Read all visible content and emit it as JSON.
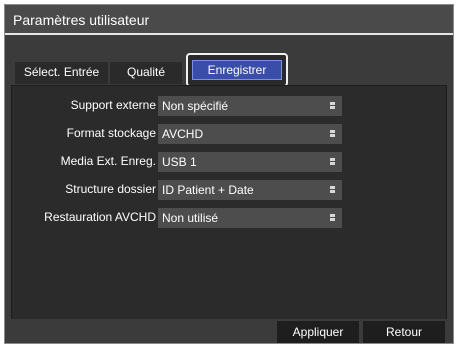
{
  "window": {
    "title": "Paramètres utilisateur"
  },
  "tabs": [
    {
      "label": "Sélect. Entrée"
    },
    {
      "label": "Qualité"
    },
    {
      "label": "Enregistrer",
      "active": true
    }
  ],
  "settings": [
    {
      "label": "Support externe",
      "value": "Non spécifié",
      "icon": "dropdown-icon"
    },
    {
      "label": "Format stockage",
      "value": "AVCHD",
      "icon": "dropdown-icon"
    },
    {
      "label": "Media Ext. Enreg.",
      "value": "USB 1",
      "icon": "dropdown-icon"
    },
    {
      "label": "Structure dossier",
      "value": "ID Patient + Date",
      "icon": "dropdown-icon"
    },
    {
      "label": "Restauration AVCHD",
      "value": "Non utilisé",
      "icon": "dropdown-icon"
    }
  ],
  "footer": {
    "apply_label": "Appliquer",
    "back_label": "Retour"
  },
  "colors": {
    "active_tab": "#3a4da8",
    "background": "#3b3b3b",
    "field": "#4d4d4d"
  }
}
